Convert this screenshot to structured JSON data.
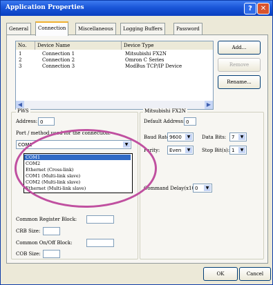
{
  "window": {
    "title": "Application Properties",
    "help_label": "?",
    "close_label": "✕"
  },
  "tabs": [
    "General",
    "Connection",
    "Miscellaneous",
    "Logging Buffers",
    "Password"
  ],
  "list": {
    "headers": [
      "No.",
      "Device Name",
      "Device Type"
    ],
    "rows": [
      [
        "1",
        "Connection 1",
        "Mitsubishi FX2N"
      ],
      [
        "2",
        "Connection 2",
        "Omron C Series"
      ],
      [
        "3",
        "Connection 3",
        "ModBus TCP/IP Device"
      ]
    ]
  },
  "buttons": {
    "add": "Add...",
    "remove": "Remove",
    "rename": "Rename...",
    "ok": "OK",
    "cancel": "Cancel"
  },
  "pws": {
    "title": "PWS",
    "address_label": "Address:",
    "address_value": "0",
    "port_label": "Port / method used for the connection:",
    "port_value": "COM1",
    "options": [
      "COM1",
      "COM2",
      "Ethernet (Cross-link)",
      "COM1 (Multi-link slave)",
      "COM2 (Multi-link slave)",
      "Ethernet (Multi-link slave)"
    ],
    "crb_label": "Common Register Block:",
    "crb_size_label": "CRB Size:",
    "cob_label": "Common On/Off Block:",
    "cob_size_label": "COB Size:"
  },
  "device": {
    "title": "Mitsubishi FX2N",
    "default_address_label": "Default Address:",
    "default_address_value": "0",
    "baud_label": "Baud Rate:",
    "baud_value": "9600",
    "databits_label": "Data Bits:",
    "databits_value": "7",
    "parity_label": "Parity:",
    "parity_value": "Even",
    "stopbits_label": "Stop Bit(s):",
    "stopbits_value": "1",
    "cmd_delay_label": "Command Delay(x10ms):",
    "cmd_delay_value": "0"
  },
  "icons": {
    "scroll_left": "◀",
    "scroll_right": "▶",
    "dropdown": "▼"
  },
  "colors": {
    "titlebar": "#1a56d8",
    "highlight_ellipse": "#c050a0",
    "selection": "#316ac5"
  }
}
